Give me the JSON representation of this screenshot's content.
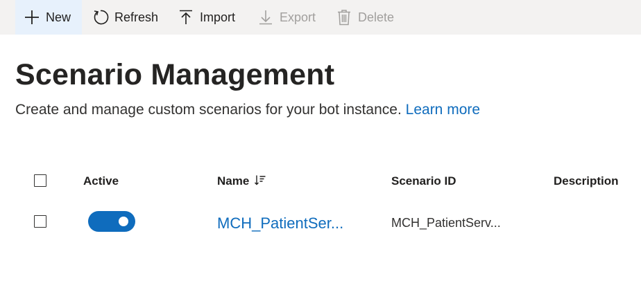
{
  "toolbar": {
    "new_label": "New",
    "refresh_label": "Refresh",
    "import_label": "Import",
    "export_label": "Export",
    "delete_label": "Delete",
    "disabled_color": "#a19f9d"
  },
  "page": {
    "title": "Scenario Management",
    "subtitle": "Create and manage custom scenarios for your bot instance.",
    "learn_more": "Learn more",
    "link_color": "#0f6cbd"
  },
  "table": {
    "columns": {
      "active": "Active",
      "name": "Name",
      "scenario_id": "Scenario ID",
      "description": "Description"
    },
    "sort_icon": "sort-descending-icon",
    "rows": [
      {
        "selected": false,
        "active": true,
        "name": "MCH_PatientSer...",
        "scenario_id": "MCH_PatientServ...",
        "description": ""
      }
    ]
  },
  "icons": [
    "plus-icon",
    "refresh-icon",
    "upload-icon",
    "download-icon",
    "trash-icon"
  ]
}
